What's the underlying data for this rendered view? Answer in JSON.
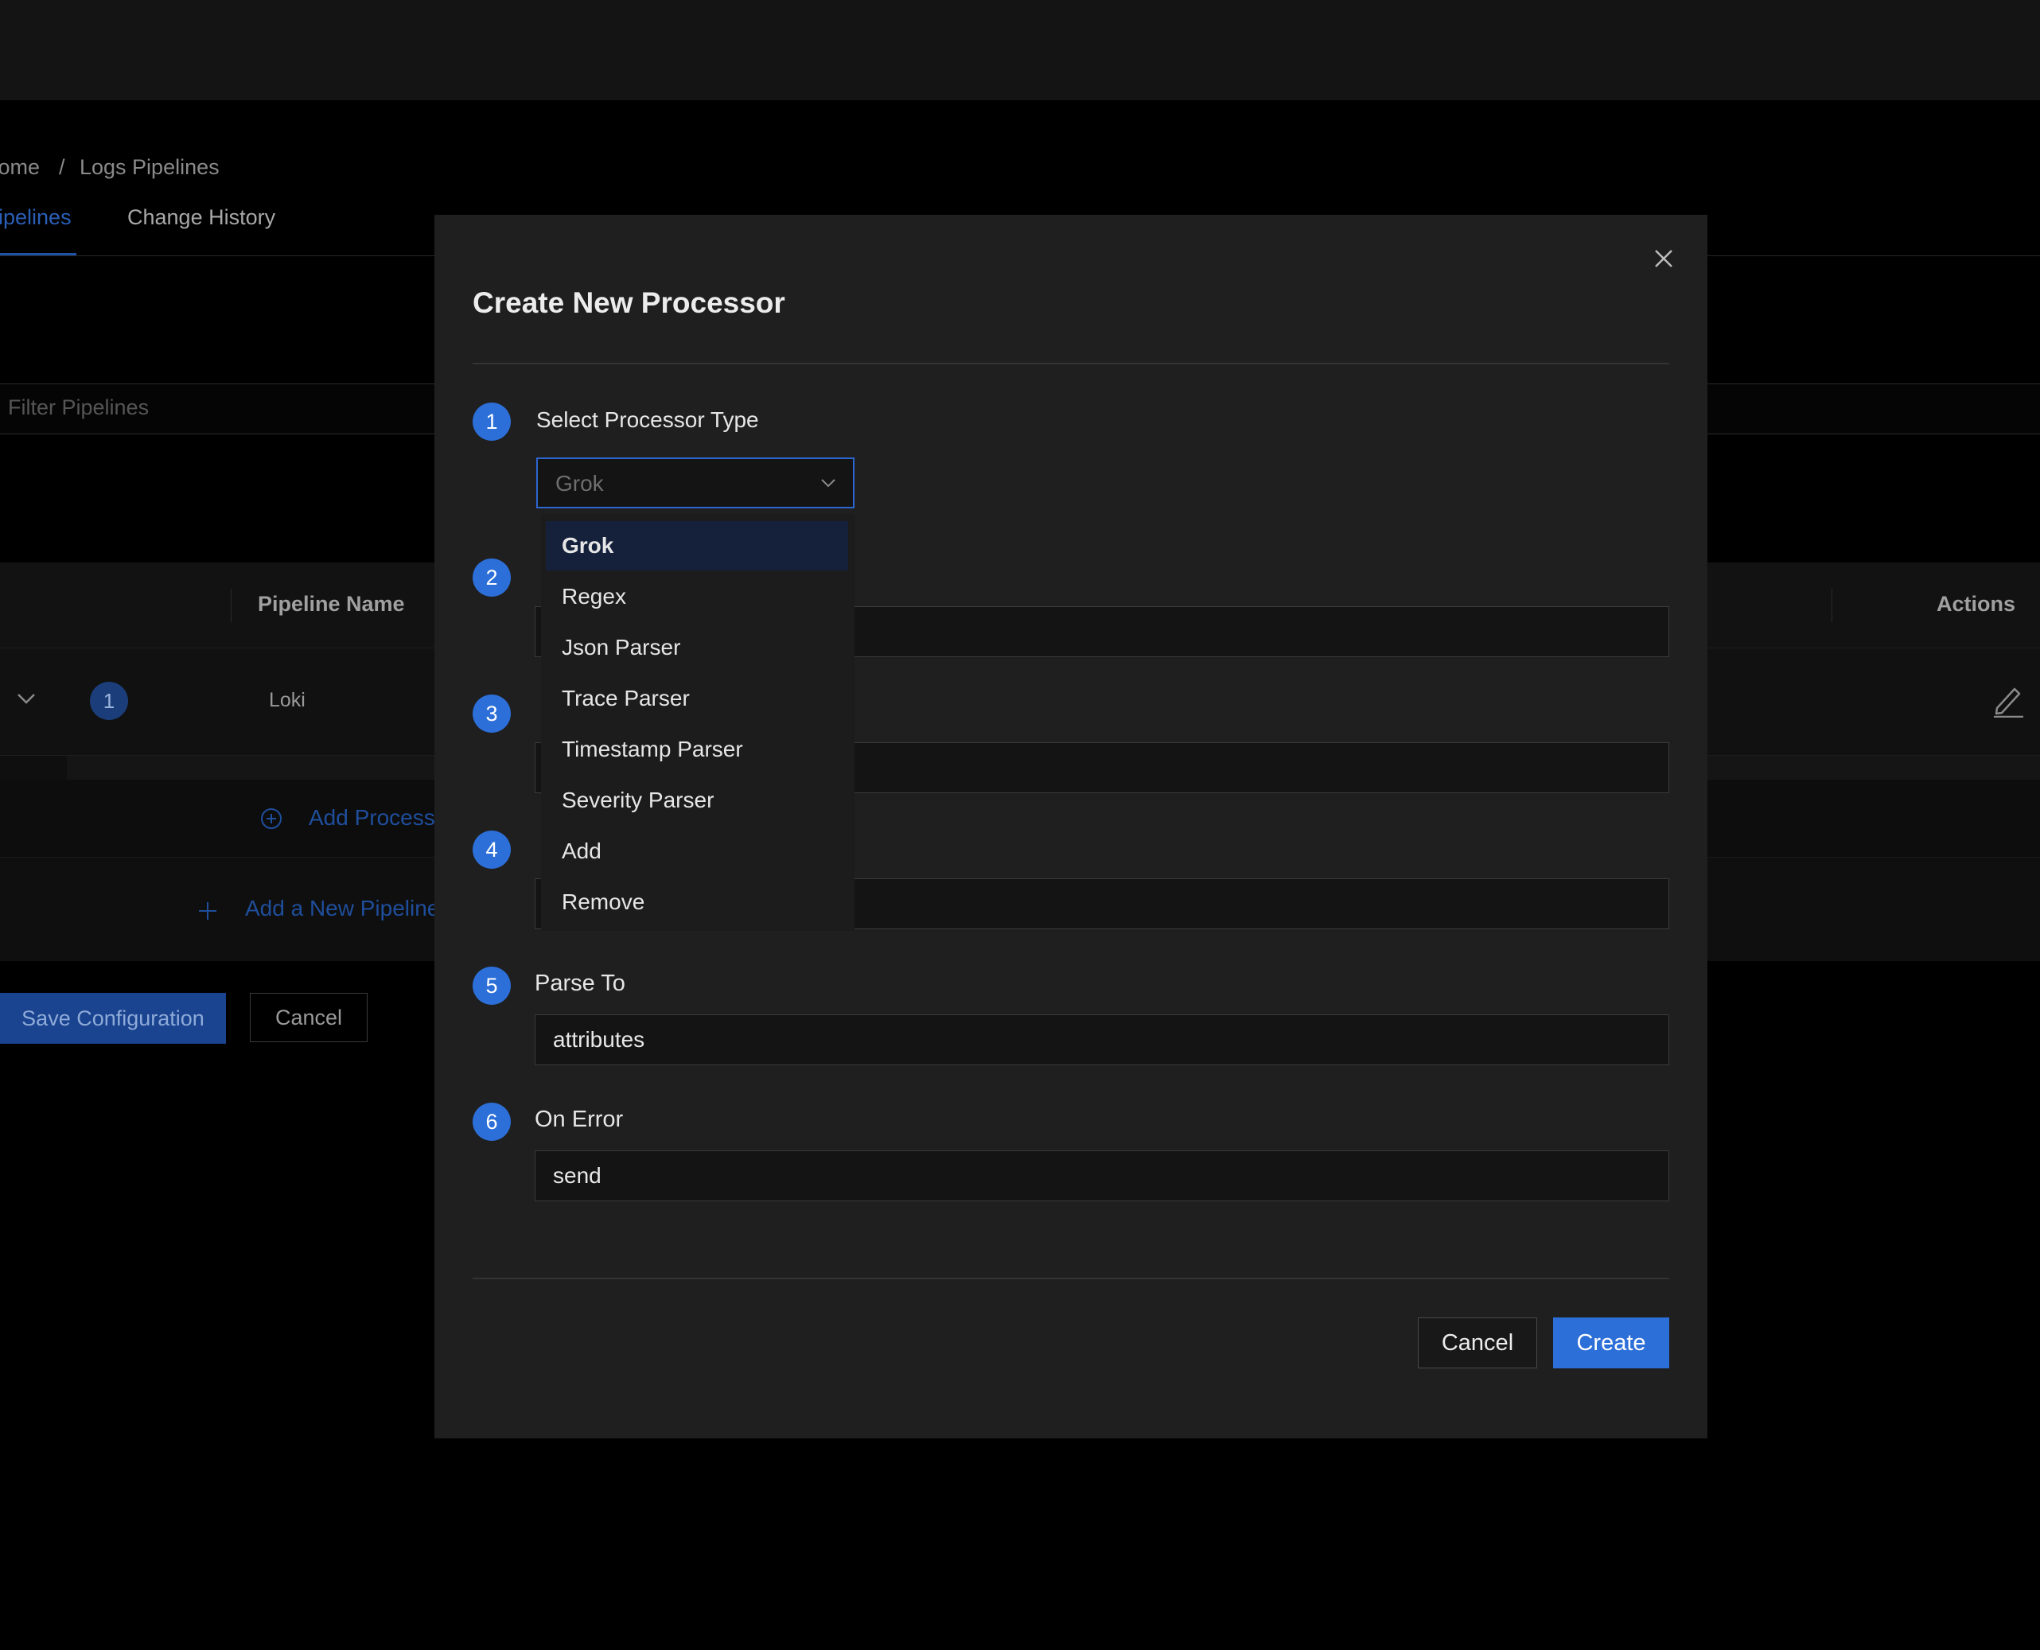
{
  "breadcrumb": {
    "home": "Home",
    "separator": "/",
    "current": "Logs Pipelines"
  },
  "tabs": [
    {
      "label": "Pipelines",
      "active": true
    },
    {
      "label": "Change History",
      "active": false
    }
  ],
  "filter": {
    "placeholder": "Filter Pipelines"
  },
  "table": {
    "columns": [
      "Pipeline Name",
      "Actions"
    ],
    "rows": [
      {
        "order": "1",
        "name": "Loki"
      }
    ],
    "add_processor_label": "Add Processor",
    "add_pipeline_label": "Add a New Pipeline"
  },
  "footer": {
    "save_label": "Save Configuration",
    "cancel_label": "Cancel"
  },
  "modal": {
    "title": "Create New Processor",
    "steps": [
      {
        "number": "1",
        "label": "Select Processor Type"
      },
      {
        "number": "2",
        "label": ""
      },
      {
        "number": "3",
        "label": ""
      },
      {
        "number": "4",
        "label": ""
      },
      {
        "number": "5",
        "label": "Parse To"
      },
      {
        "number": "6",
        "label": "On Error"
      }
    ],
    "processor_type": {
      "value": "Grok"
    },
    "dropdown_options": [
      "Grok",
      "Regex",
      "Json Parser",
      "Trace Parser",
      "Timestamp Parser",
      "Severity Parser",
      "Add",
      "Remove"
    ],
    "dropdown_selected": "Grok",
    "fields": {
      "field2": "",
      "field3": "",
      "field4": "",
      "parse_to": "attributes",
      "on_error": "send"
    },
    "cancel_label": "Cancel",
    "create_label": "Create"
  },
  "colors": {
    "accent": "#2d6fd8",
    "modal_bg": "#1f1f1f",
    "page_bg": "#000000",
    "active_option_bg": "#15213b"
  },
  "icons": {
    "close": "close-icon",
    "select_chevron": "chevron-down-icon",
    "row_expand": "chevron-down-icon",
    "edit": "pencil-icon",
    "add_processor": "plus-circle-icon",
    "add_pipeline": "plus-icon"
  }
}
